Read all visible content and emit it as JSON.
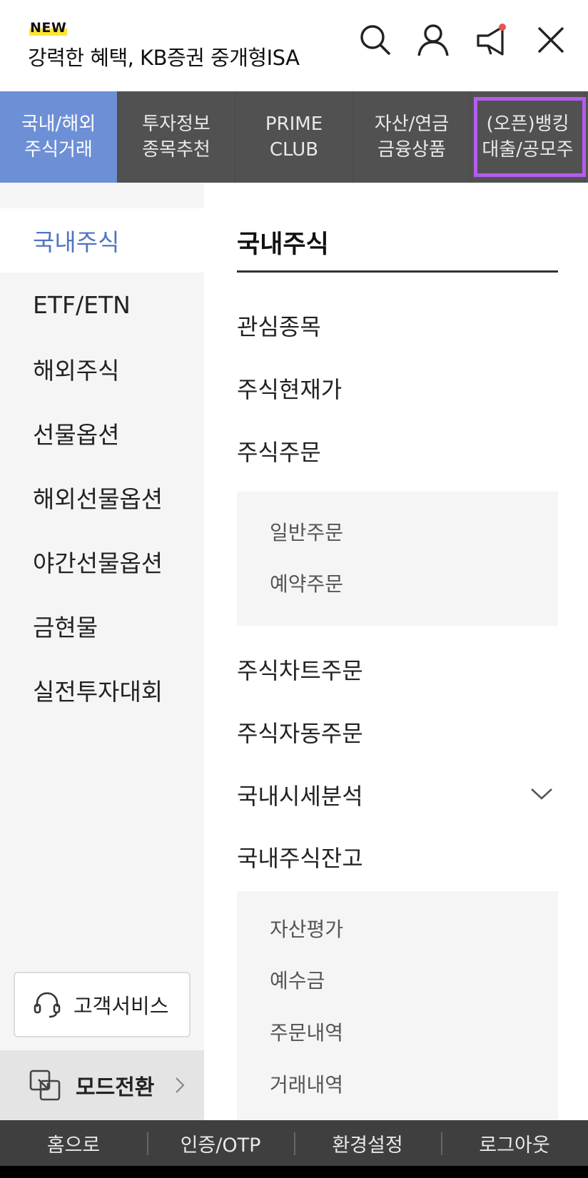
{
  "header": {
    "new_badge": "NEW",
    "promo_text": "강력한 혜택, KB증권 중개형ISA",
    "icons": [
      "search-icon",
      "user-icon",
      "announcement-icon",
      "close-icon"
    ],
    "notification_dot_color": "#ef5350"
  },
  "tabs": [
    {
      "line1": "국내/해외",
      "line2": "주식거래",
      "active": true
    },
    {
      "line1": "투자정보",
      "line2": "종목추천",
      "active": false
    },
    {
      "line1": "PRIME",
      "line2": "CLUB",
      "active": false
    },
    {
      "line1": "자산/연금",
      "line2": "금융상품",
      "active": false
    },
    {
      "line1": "(오픈)뱅킹",
      "line2": "대출/공모주",
      "active": false
    }
  ],
  "left_menu": {
    "items": [
      "국내주식",
      "ETF/ETN",
      "해외주식",
      "선물옵션",
      "해외선물옵션",
      "야간선물옵션",
      "금현물",
      "실전투자대회"
    ],
    "active_index": 0,
    "customer_service_label": "고객서비스",
    "mode_switch_label": "모드전환"
  },
  "content": {
    "section_title": "국내주식",
    "items": {
      "watchlist": "관심종목",
      "current_price": "주식현재가",
      "stock_order": "주식주문",
      "order_sub": [
        "일반주문",
        "예약주문"
      ],
      "chart_order": "주식차트주문",
      "auto_order": "주식자동주문",
      "market_analysis": "국내시세분석",
      "balance": "국내주식잔고",
      "balance_sub": [
        "자산평가",
        "예수금",
        "주문내역",
        "거래내역"
      ]
    }
  },
  "footer": {
    "items": [
      "홈으로",
      "인증/OTP",
      "환경설정",
      "로그아웃"
    ]
  },
  "colors": {
    "accent": "#6c8fd6",
    "active_text": "#4f75c0",
    "tab_bg": "#515151",
    "highlight_border": "#b45cf0",
    "footer_bg": "#3f3f3f"
  }
}
